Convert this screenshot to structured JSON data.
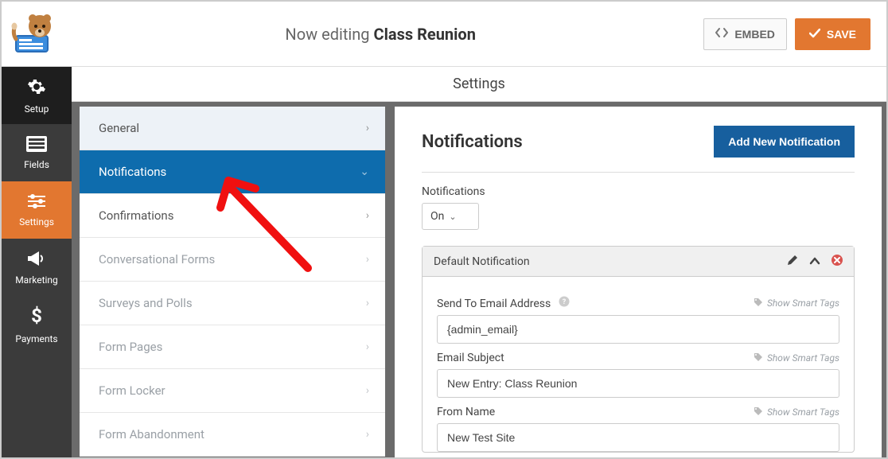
{
  "header": {
    "editing_prefix": "Now editing ",
    "form_name": "Class Reunion",
    "embed_label": "EMBED",
    "save_label": "SAVE"
  },
  "rail": {
    "items": [
      {
        "label": "Setup"
      },
      {
        "label": "Fields"
      },
      {
        "label": "Settings"
      },
      {
        "label": "Marketing"
      },
      {
        "label": "Payments"
      }
    ]
  },
  "secondary_title": "Settings",
  "settings_list": [
    {
      "label": "General",
      "style": "light"
    },
    {
      "label": "Notifications",
      "style": "active"
    },
    {
      "label": "Confirmations",
      "style": "plain"
    },
    {
      "label": "Conversational Forms",
      "style": "disabled"
    },
    {
      "label": "Surveys and Polls",
      "style": "disabled"
    },
    {
      "label": "Form Pages",
      "style": "disabled"
    },
    {
      "label": "Form Locker",
      "style": "disabled"
    },
    {
      "label": "Form Abandonment",
      "style": "disabled"
    }
  ],
  "panel": {
    "title": "Notifications",
    "add_button": "Add New Notification",
    "toggle_label": "Notifications",
    "toggle_value": "On",
    "card_title": "Default Notification",
    "smart_tags_label": "Show Smart Tags",
    "fields": {
      "send_to": {
        "label": "Send To Email Address",
        "value": "{admin_email}"
      },
      "subject": {
        "label": "Email Subject",
        "value": "New Entry: Class Reunion"
      },
      "from_name": {
        "label": "From Name",
        "value": "New Test Site"
      }
    }
  }
}
